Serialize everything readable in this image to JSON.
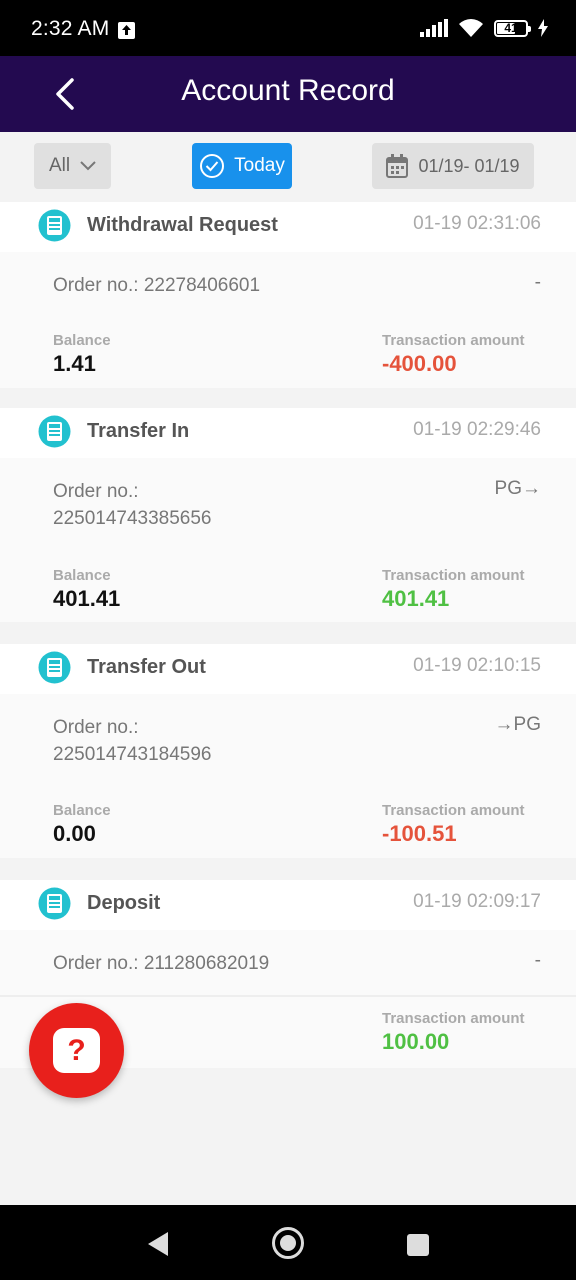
{
  "status_bar": {
    "time": "2:32 AM",
    "battery": "41"
  },
  "header": {
    "title": "Account Record"
  },
  "filters": {
    "all_label": "All",
    "today_label": "Today",
    "date_range": "01/19- 01/19"
  },
  "records": [
    {
      "type": "Withdrawal Request",
      "time": "01-19 02:31:06",
      "order_label": "Order no.:",
      "order_no": "22278406601",
      "route": "-",
      "balance_label": "Balance",
      "balance": "1.41",
      "amount_label": "Transaction amount",
      "amount": "-400.00"
    },
    {
      "type": "Transfer In",
      "time": "01-19 02:29:46",
      "order_label": "Order no.:",
      "order_no": "225014743385656",
      "route": "PG→",
      "balance_label": "Balance",
      "balance": "401.41",
      "amount_label": "Transaction amount",
      "amount": "401.41"
    },
    {
      "type": "Transfer Out",
      "time": "01-19 02:10:15",
      "order_label": "Order no.:",
      "order_no": "225014743184596",
      "route": "→PG",
      "balance_label": "Balance",
      "balance": "0.00",
      "amount_label": "Transaction amount",
      "amount": "-100.51"
    },
    {
      "type": "Deposit",
      "time": "01-19 02:09:17",
      "order_label": "Order no.:",
      "order_no": "211280682019",
      "route": "-",
      "amount_label": "Transaction amount",
      "amount": "100.00"
    }
  ],
  "help_button": {
    "glyph": "?"
  },
  "colors": {
    "header_bg": "#230a50",
    "accent": "#1891ec",
    "negative": "#e5533b",
    "positive": "#4fc043",
    "help": "#e8201c"
  }
}
